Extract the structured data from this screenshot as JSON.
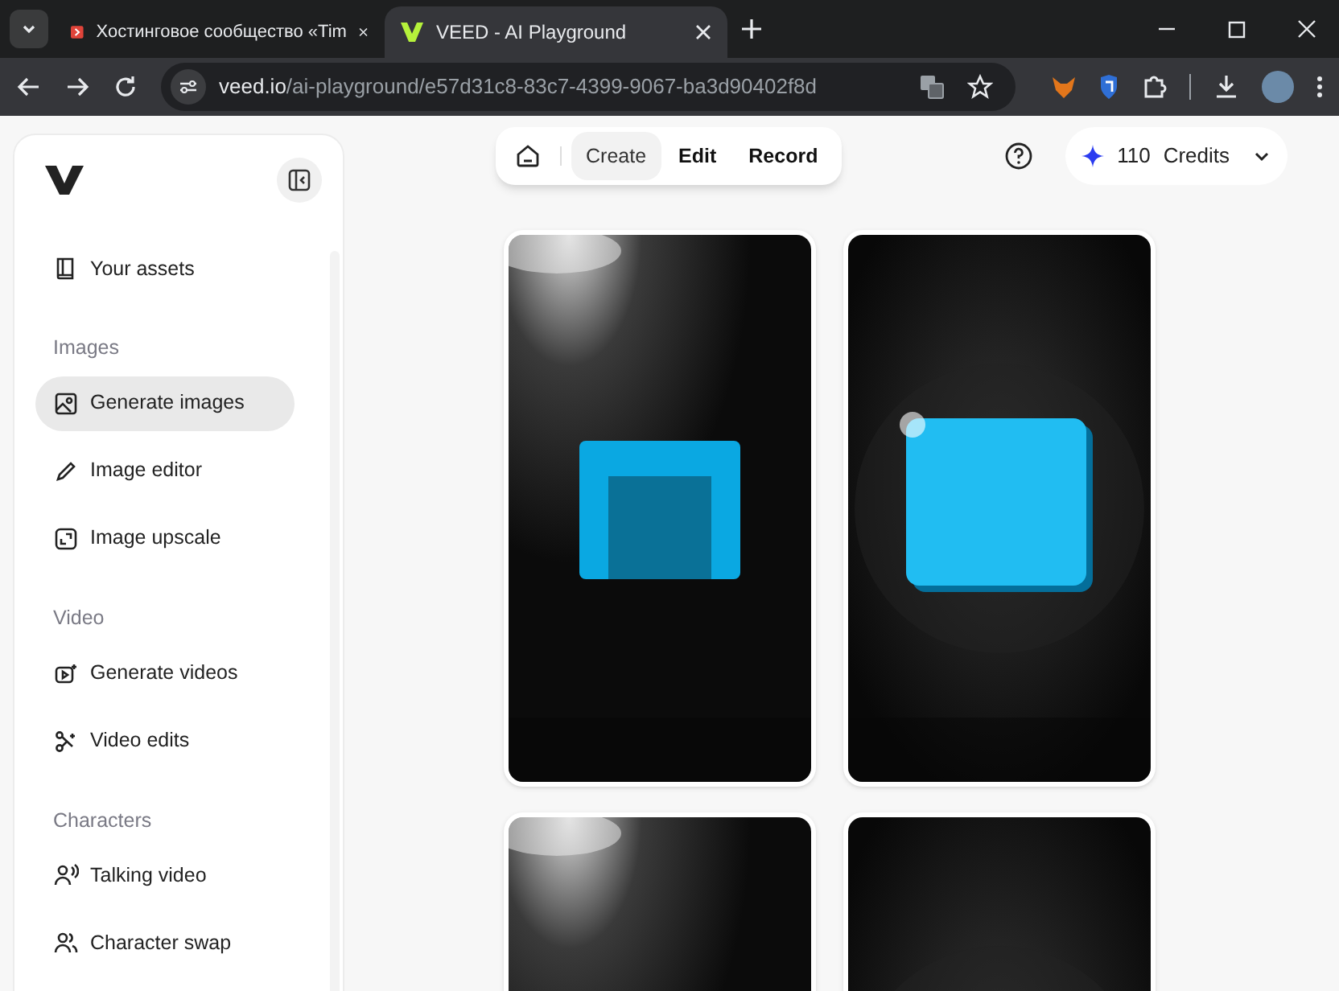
{
  "browser": {
    "tabs": [
      {
        "title": "Хостинговое сообщество «Tim",
        "selected": false
      },
      {
        "title": "VEED - AI Playground",
        "selected": true
      }
    ],
    "url": {
      "host": "veed.io",
      "path": "/ai-playground/e57d31c8-83c7-4399-9067-ba3d90402f8d"
    }
  },
  "sidebar": {
    "sections": [
      {
        "items": [
          {
            "label": "Your assets",
            "selected": false
          }
        ]
      },
      {
        "title": "Images",
        "items": [
          {
            "label": "Generate images",
            "selected": true
          },
          {
            "label": "Image editor",
            "selected": false
          },
          {
            "label": "Image upscale",
            "selected": false
          }
        ]
      },
      {
        "title": "Video",
        "items": [
          {
            "label": "Generate videos",
            "selected": false
          },
          {
            "label": "Video edits",
            "selected": false
          }
        ]
      },
      {
        "title": "Characters",
        "items": [
          {
            "label": "Talking video",
            "selected": false
          },
          {
            "label": "Character swap",
            "selected": false
          }
        ]
      }
    ]
  },
  "toolbar": {
    "modes": [
      {
        "label": "Create",
        "selected": true
      },
      {
        "label": "Edit",
        "selected": false
      },
      {
        "label": "Record",
        "selected": false
      }
    ]
  },
  "credits": {
    "count": "110",
    "label": "Credits"
  }
}
